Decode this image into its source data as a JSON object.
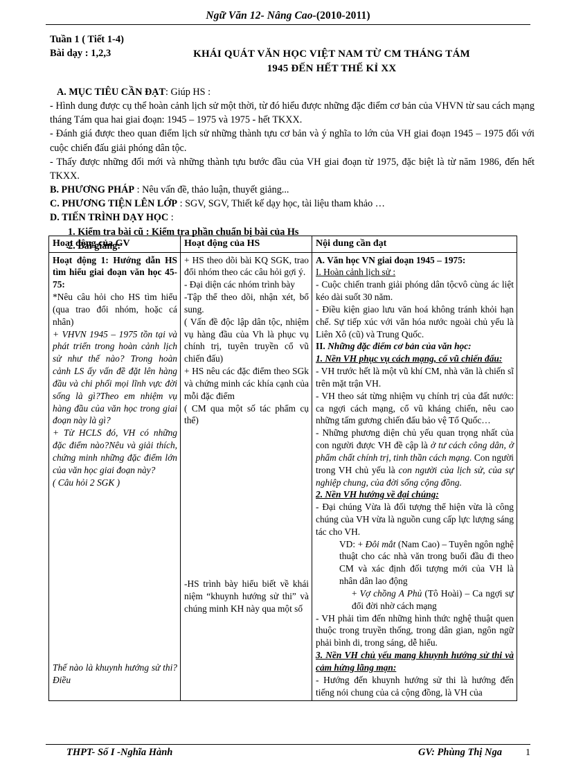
{
  "document": {
    "running_header": "Ngữ Văn 12- Nâng Cao-",
    "running_header_year": "(2010-2011)"
  },
  "meta": {
    "week_label": "Tuần 1 ( Tiết 1-4)",
    "lesson_label": "Bài dạy :  1,2,3",
    "title_line1": "KHÁI QUÁT  VĂN HỌC  VIỆT  NAM TỪ  CM THÁNG  TÁM",
    "title_line2": "1945 ĐẾN HẾT  THẾ KỈ XX"
  },
  "objectives": {
    "heading": "A. MỤC TIÊU CẦN ĐẠT",
    "heading_rest": ": Giúp  HS :",
    "items": [
      "- Hình  dung  được cụ thể  hoàn  cảnh lịch  sử một thời,  từ đó hiểu  được những  đặc  điểm  cơ bản của VHVN từ sau cách mạng  tháng  Tám qua hai  giai  đoạn:  1945 – 1975 và 1975 - hết TKXX.",
      "- Đánh giá được theo  quan  điểm  lịch  sử những  thành  tựu cơ bản và ý nghĩa  to lớn  của VH giai  đoạn 1945 – 1975 đối với  cuộc chiến  đấu giải  phóng  dân tộc.",
      "- Thấy  được những  đổi mới  và những  thành  tựu bước đầu của VH giai  đoạn từ 1975, đặc biệt là từ năm 1986, đến hết TKXX."
    ]
  },
  "method": {
    "heading": "B. PHƯƠNG PHÁP",
    "rest": " : Nêu vấn đề, thảo luận,  thuyết  giảng..."
  },
  "means": {
    "heading": "C. PHƯƠNG TIỆN LÊN LỚP",
    "rest": " : SGV, SGV, Thiết kế dạy học, tài liệu  tham khảo …"
  },
  "procedure": {
    "heading": "D. TIẾN TRÌNH DẠY HỌC",
    "rest": " :",
    "step1": "1. Kiểm tra bài cũ : Kiểm tra phần chuẩn bị bài của Hs",
    "step2": "2. Bài giảng:"
  },
  "table": {
    "headers": [
      "Hoạt động của GV",
      "Hoạt động của  HS",
      "Nội dung  cần đạt"
    ],
    "col_gv": {
      "activity_title": "Hoạt  động  1:  Hướng dẫn HS tìm hiểu  giai đoạn văn học 45-75:",
      "p1": "*Nêu câu hỏi  cho HS tìm  hiểu  (qua trao đổi nhóm, hoặc cá nhân)",
      "q1": "+ VHVN 1945 – 1975 tồn tại và phát triển trong hoàn cảnh lịch sử như thế nào? Trong hoàn cảnh LS ấy vấn đề đặt lên hàng đầu và chi phối mọi lĩnh vực đời sống là gì?Theo em nhiệm vụ hàng đầu của văn học trong giai đoạn này là gì?",
      "q2": "+ Từ HCLS đó, VH có những đặc điểm nào?Nêu và giải thích, chứng minh những đặc điểm lớn của văn học giai đoạn này?",
      "q2_ref": "( Câu hỏi 2 SGK )",
      "q3": "Thế nào là khuynh hướng sử thi? Điều"
    },
    "col_hs": {
      "p1": "+ HS theo  dõi bài KQ SGK, trao đổi nhóm theo các câu hỏi gợi ý.",
      "p2": "- Đại  diện  các  nhóm trình  bày",
      "p3": "-Tập thể  theo  dõi,  nhận xét, bổ sung.",
      "p4": "( Vấn đề độc lập dân tộc, nhiệm  vụ hàng  đầu của Vh là phục vụ chính  trị, tuyên  truyền  cổ vũ chiến đấu)",
      "p5": "+ HS nêu các đặc điểm theo SGk và chứng  minh các  khía  cạnh  của  mỗi đặc điểm",
      "p6": "( CM qua  một  số tác phẩm cụ thể)",
      "p7": "-HS trình  bày hiểu  biết về  khái  niệm  “khuynh hướng sử thi”  và chúng minh  KH này qua một số"
    },
    "col_content": {
      "part_a": "A. Văn học VN giai đoạn 1945 – 1975:",
      "sec_1_head": "I.  Hoàn cảnh lịch  sử :",
      "sec_1_p1": "- Cuộc chiến  tranh  giải  phóng  dân tộcvô cùng ác liệt kéo dài suốt 30 năm.",
      "sec_1_p2": "- Điều  kiện  giao  lưu  văn  hoá không  tránh  khỏi hạn chế. Sự tiếp xúc với văn hóa nước ngoài chủ yếu là Liên  Xô (cũ) và Trung  Quốc.",
      "sec_2_head_num": " II. ",
      "sec_2_head": "Những đặc điểm cơ bản của văn học:",
      "sub1_head": "1. Nền VH phục vụ cách mạng, cổ vũ chiến đấu:",
      "sub1_p1": "- VH trước hết là một vũ khí CM, nhà văn là chiến sĩ trên mặt trận VH.",
      "sub1_p2_a": "- VH theo sát từng nhiệm  vụ chính  trị của đất nước: ca ngợi cách mạng,  cổ vũ kháng chiến,  nêu cao những  tấm  gương  chiến  đấu bảo vệ Tổ Quốc…",
      "sub1_p3_a": "- Những phương diện chủ yếu quan trọng nhất của con người được VH  đề cập là ",
      "sub1_p3_i1": "ở tư cách công dân, ở phẩm chất chính trị, tinh thần cách mạng.",
      "sub1_p3_b": " Con người trong VH chủ yếu là ",
      "sub1_p3_i2": "con người của lịch sử, của sự nghiệp chung, của đời sống cộng đồng.",
      "sub2_head": "2. Nền VH hướng về đại chúng:",
      "sub2_p1": "- Đại chúng Vừa  là  đối tượng thể hiện   vừa là công chúng  của VH vừa là nguồn  cung  cấp lực lượng sáng tác cho VH.",
      "sub2_vd1_a": "VD: + ",
      "sub2_vd1_i": "Đôi mắt",
      "sub2_vd1_b": " (Nam  Cao) – Tuyên  ngôn nghệ  thuật  cho các nhà văn trong buổi đầu đi theo CM và xác định đối tượng mới của VH là nhân dân lao động",
      "sub2_vd2_a": "+ ",
      "sub2_vd2_i": "Vợ chồng A Phủ",
      "sub2_vd2_b": " (Tô Hoài) – Ca ngợi sự đổi đời nhờ cách mạng",
      "sub2_p2": "- VH phải tìm  đến những  hình  thức nghệ  thuật quen  thuộc  trong  truyền  thống,  trong  dân gian, ngôn ngữ phải bình di, trong sáng,  dễ hiểu.",
      "sub3_head": "3. Nền VH chủ yếu mang khuynh hướng sử thi và cảm hứng lãng mạn:",
      "sub3_p1": "- Hướng  đến khuynh  hướng  sử thi là hướng  đến tiếng  nói  chung  của cả cộng  đồng,  là VH của"
    }
  },
  "footer": {
    "school": "THPT- Số I -Nghĩa Hành",
    "teacher": "GV: Phùng Thị Nga",
    "page_number": "1"
  }
}
